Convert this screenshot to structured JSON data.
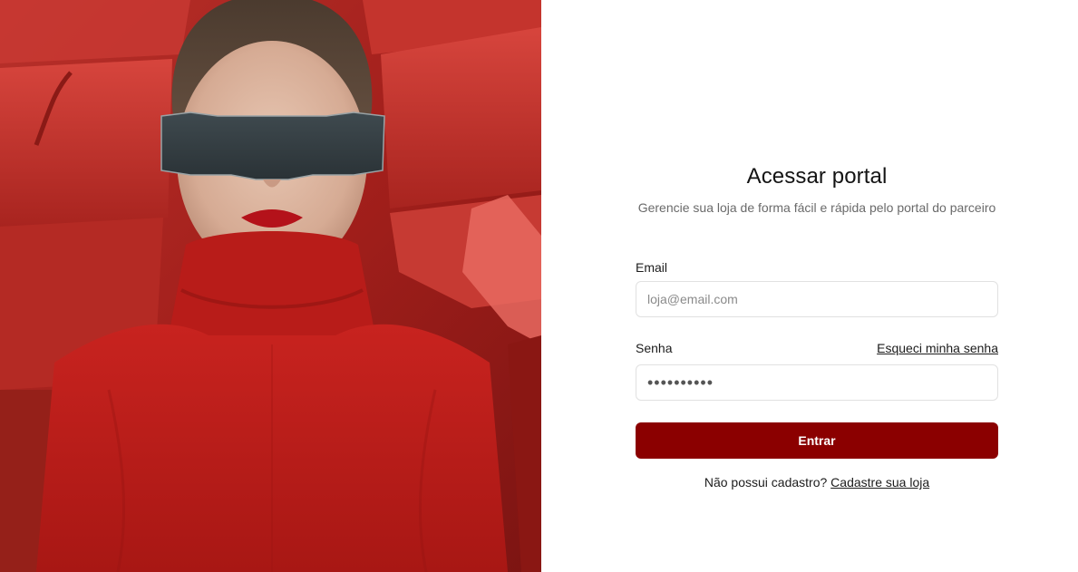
{
  "hero": {
    "image_subject": "model-red-turtleneck-visor"
  },
  "login": {
    "title": "Acessar portal",
    "subtitle": "Gerencie sua loja de forma fácil e rápida pelo portal do parceiro",
    "email_label": "Email",
    "email_placeholder": "loja@email.com",
    "email_value": "",
    "password_label": "Senha",
    "forgot_link": "Esqueci minha senha",
    "password_value": "••••••••••",
    "submit_label": "Entrar",
    "signup_prompt": "Não possui cadastro?",
    "signup_link": "Cadastre sua loja"
  },
  "colors": {
    "primary": "#8b0000",
    "hero_background": "#a8201c",
    "text": "#1c1c1c",
    "muted_text": "#6a6a6a",
    "input_border": "#e1e1e1"
  }
}
